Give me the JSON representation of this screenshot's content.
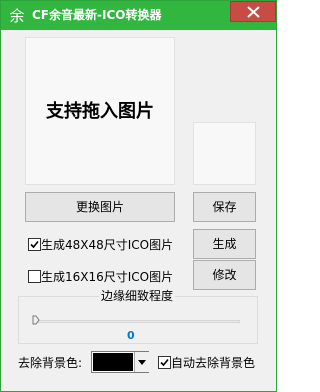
{
  "window": {
    "title": "CF余音最新-ICO转换器",
    "app_icon": "余",
    "close_icon": "close-icon"
  },
  "drop_area": {
    "hint": "支持拖入图片"
  },
  "buttons": {
    "replace": "更换图片",
    "save": "保存",
    "generate": "生成",
    "modify": "修改"
  },
  "options": {
    "size48": {
      "label": "生成48X48尺寸ICO图片",
      "checked": true
    },
    "size16": {
      "label": "生成16X16尺寸ICO图片",
      "checked": false
    }
  },
  "edge": {
    "label": "边缘细致程度",
    "value": "0"
  },
  "background": {
    "label": "去除背景色:",
    "color": "#000000",
    "auto_remove_label": "自动去除背景色",
    "auto_remove_checked": true
  },
  "colors": {
    "titlebar": "#31b640",
    "close_button": "#c74d44",
    "slider_value": "#0078d7"
  }
}
